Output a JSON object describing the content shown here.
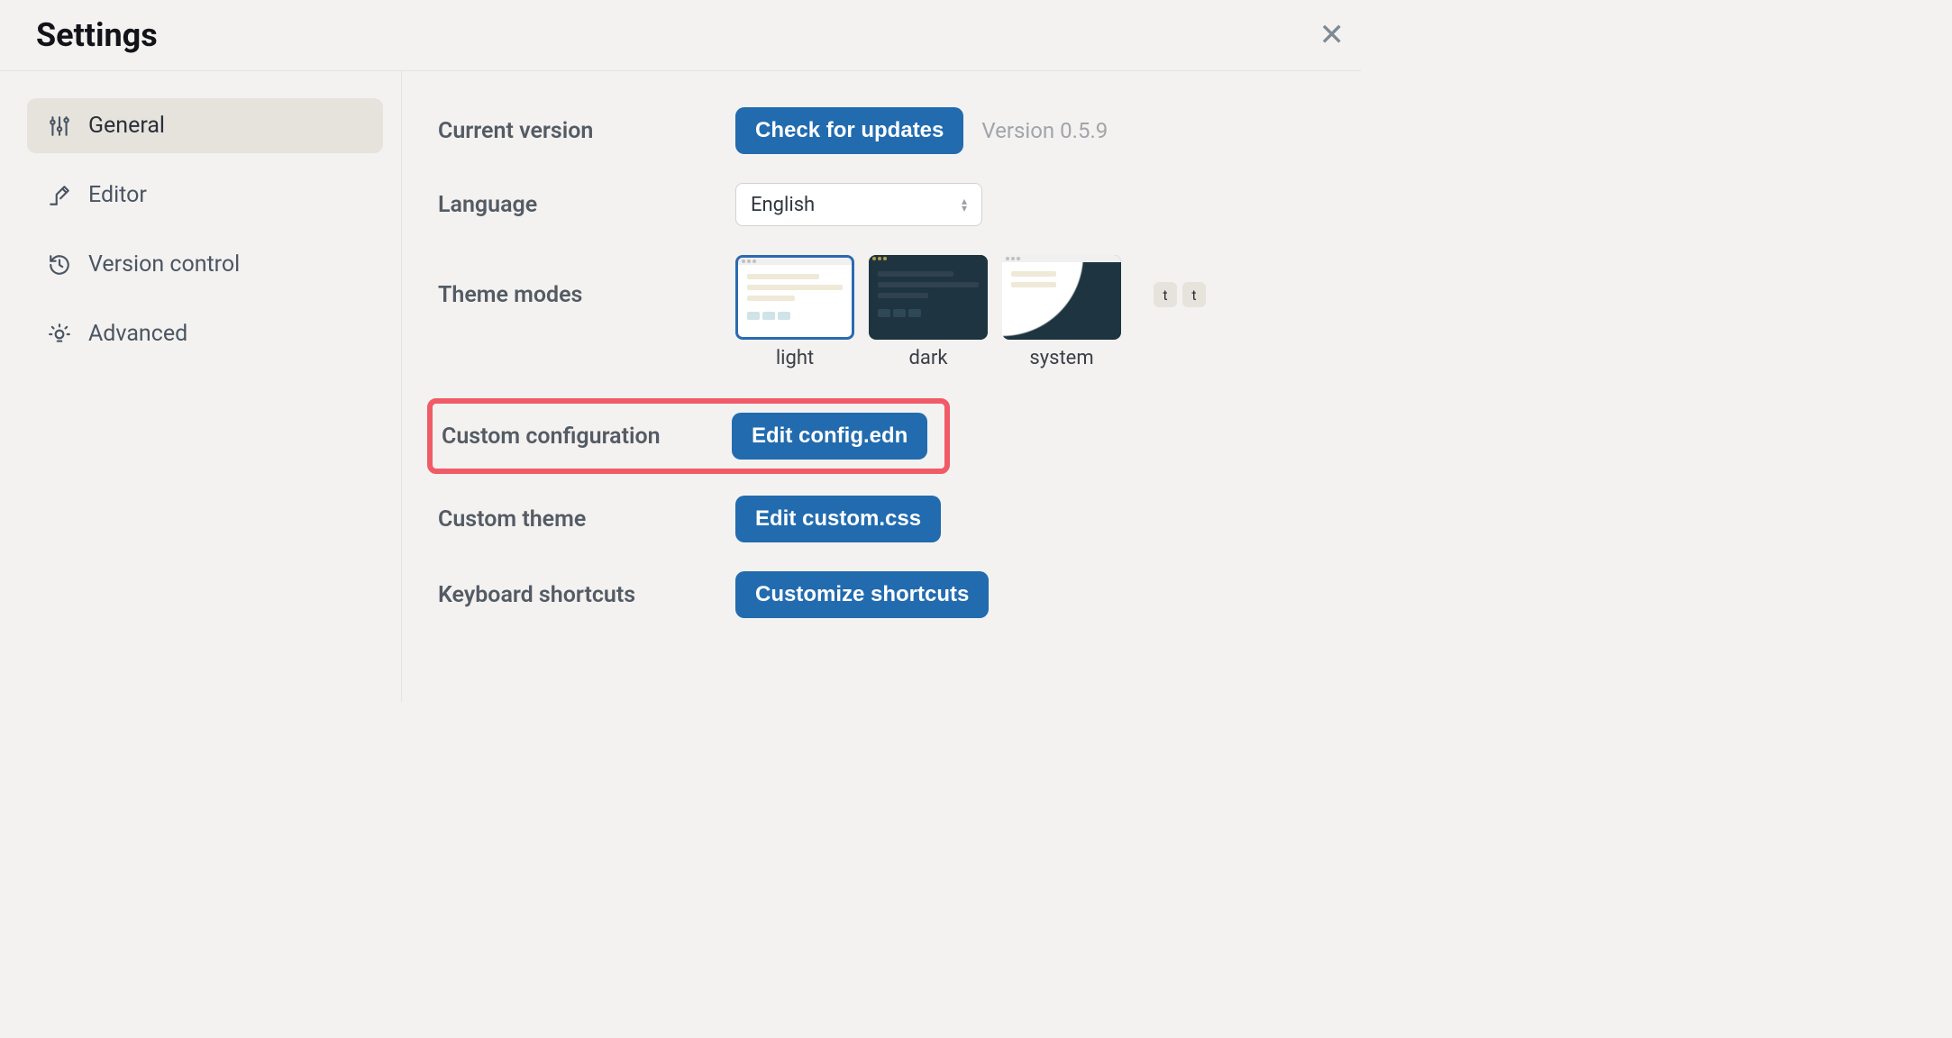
{
  "header": {
    "title": "Settings"
  },
  "sidebar": {
    "items": [
      {
        "label": "General"
      },
      {
        "label": "Editor"
      },
      {
        "label": "Version control"
      },
      {
        "label": "Advanced"
      }
    ]
  },
  "main": {
    "current_version": {
      "label": "Current version",
      "button": "Check for updates",
      "version_text": "Version 0.5.9"
    },
    "language": {
      "label": "Language",
      "value": "English"
    },
    "theme_modes": {
      "label": "Theme modes",
      "options": [
        {
          "label": "light"
        },
        {
          "label": "dark"
        },
        {
          "label": "system"
        }
      ],
      "badge1": "t",
      "badge2": "t"
    },
    "custom_config": {
      "label": "Custom configuration",
      "button": "Edit config.edn"
    },
    "custom_theme": {
      "label": "Custom theme",
      "button": "Edit custom.css"
    },
    "keyboard_shortcuts": {
      "label": "Keyboard shortcuts",
      "button": "Customize shortcuts"
    }
  }
}
